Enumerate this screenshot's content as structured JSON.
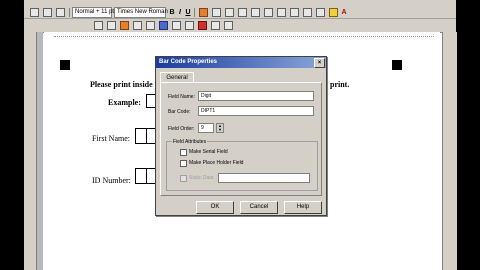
{
  "toolbar": {
    "style_box": "Normal + 11 pt",
    "font_box": "Times New Roman",
    "bold_glyph": "B",
    "italic_glyph": "I",
    "underline_glyph": "U",
    "font_color_glyph": "A"
  },
  "document": {
    "instruction_start": "Please print inside",
    "instruction_end": "print.",
    "example_label": "Example:",
    "first_name_label": "First Name:",
    "id_number_label": "ID Number:"
  },
  "dialog": {
    "title": "Bar Code Properties",
    "close_glyph": "×",
    "tab_general": "General",
    "field_name_label": "Field Name:",
    "field_name_value": "Digit",
    "bar_code_label": "Bar Code:",
    "bar_code_value": "DIPT1",
    "field_order_label": "Field Order:",
    "field_order_value": "9",
    "attributes_label": "Field Attributes",
    "make_serial_label": "Make Serial Field",
    "make_place_holder_label": "Make Place Holder Field",
    "static_data_label": "Static Data",
    "ok_label": "OK",
    "cancel_label": "Cancel",
    "help_label": "Help"
  }
}
